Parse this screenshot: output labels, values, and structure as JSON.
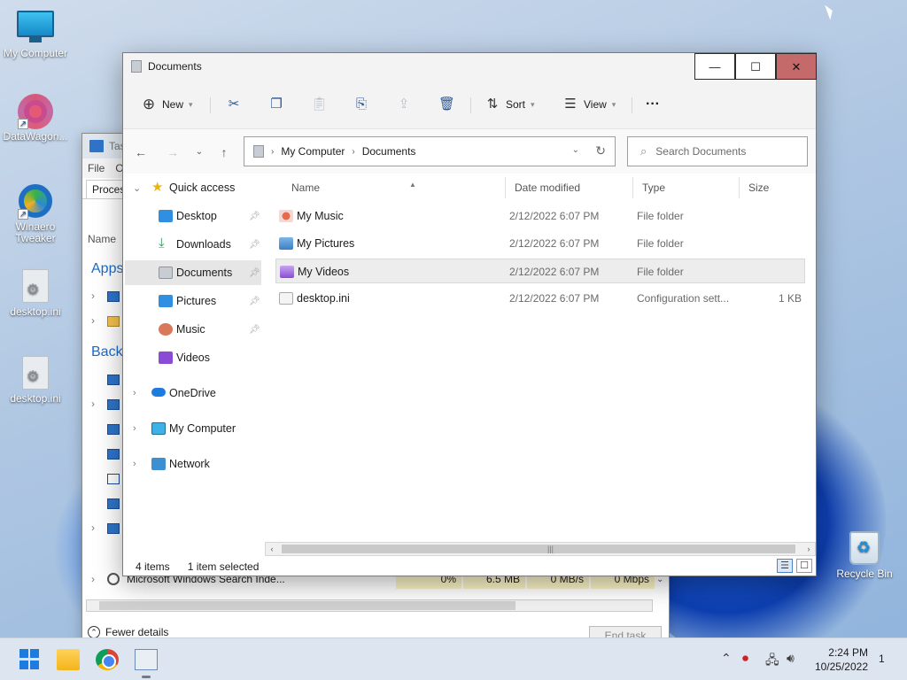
{
  "desktop": {
    "icons": [
      {
        "label": "My Computer"
      },
      {
        "label": "DataWagon..."
      },
      {
        "label": "Winaero Tweaker"
      },
      {
        "label": "desktop.ini"
      },
      {
        "label": "desktop.ini"
      },
      {
        "label": "Recycle Bin"
      }
    ]
  },
  "task_manager": {
    "title": "Tas",
    "menu": [
      "File",
      "O"
    ],
    "tab": "Process",
    "column": "Name",
    "groups": [
      "Apps",
      "Backg"
    ],
    "bottom_row": {
      "name": "Microsoft Windows Search Inde...",
      "cpu": "0%",
      "memory": "6.5 MB",
      "disk": "0 MB/s",
      "network": "0 Mbps"
    },
    "fewer_details": "Fewer details",
    "end_task": "End task"
  },
  "explorer": {
    "title": "Documents",
    "window_buttons": {
      "minimize": "—",
      "maximize": "☐",
      "close": "✕"
    },
    "toolbar": {
      "new_label": "New",
      "sort_label": "Sort",
      "view_label": "View",
      "more_label": "···"
    },
    "address": {
      "segments": [
        "My Computer",
        "Documents"
      ]
    },
    "search": {
      "placeholder": "Search Documents"
    },
    "nav": {
      "quick_access": "Quick access",
      "items": [
        {
          "label": "Desktop",
          "pinned": true
        },
        {
          "label": "Downloads",
          "pinned": true
        },
        {
          "label": "Documents",
          "pinned": true,
          "selected": true
        },
        {
          "label": "Pictures",
          "pinned": true
        },
        {
          "label": "Music",
          "pinned": true
        },
        {
          "label": "Videos",
          "pinned": false
        }
      ],
      "onedrive": "OneDrive",
      "my_computer": "My Computer",
      "network": "Network"
    },
    "columns": {
      "name": "Name",
      "date": "Date modified",
      "type": "Type",
      "size": "Size"
    },
    "files": [
      {
        "name": "My Music",
        "date": "2/12/2022 6:07 PM",
        "type": "File folder",
        "size": "",
        "icon": "music-folder-icon"
      },
      {
        "name": "My Pictures",
        "date": "2/12/2022 6:07 PM",
        "type": "File folder",
        "size": "",
        "icon": "pictures-folder-icon"
      },
      {
        "name": "My Videos",
        "date": "2/12/2022 6:07 PM",
        "type": "File folder",
        "size": "",
        "icon": "videos-folder-icon"
      },
      {
        "name": "desktop.ini",
        "date": "2/12/2022 6:07 PM",
        "type": "Configuration sett...",
        "size": "1 KB",
        "icon": "config-file-icon"
      }
    ],
    "status": {
      "count": "4 items",
      "selected": "1 item selected"
    }
  },
  "taskbar": {
    "time": "2:24 PM",
    "date": "10/25/2022",
    "notifications": "1"
  },
  "colors": {
    "accent": "#1e7ce0",
    "close_button": "#c56a6a",
    "selection": "#e6e6e6"
  }
}
